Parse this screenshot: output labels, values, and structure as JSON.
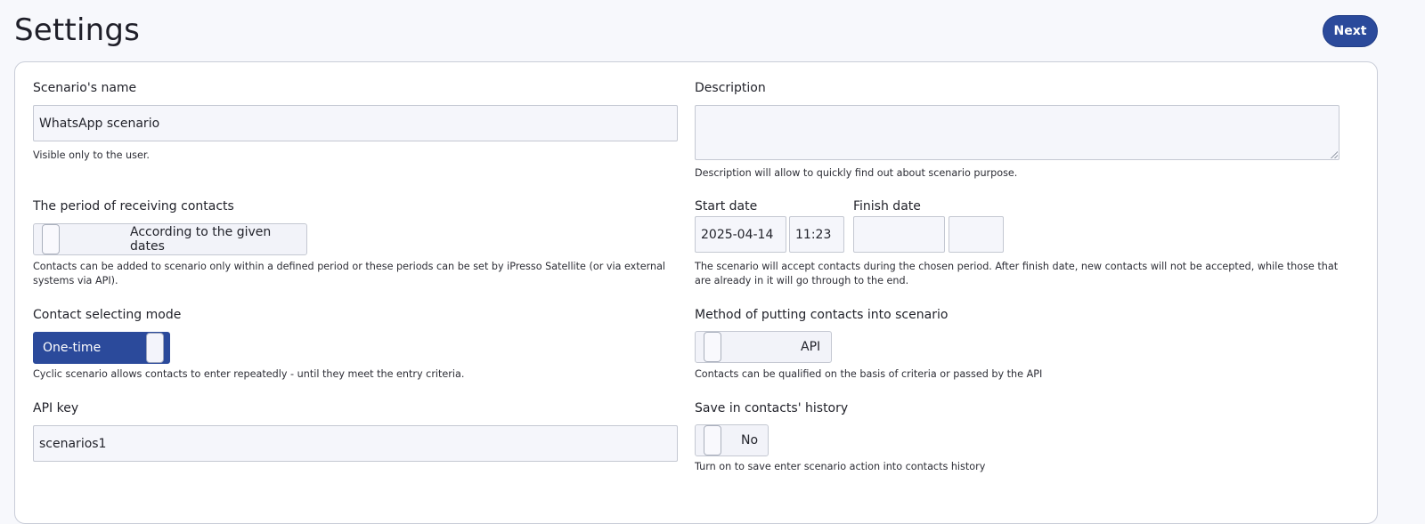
{
  "header": {
    "title": "Settings",
    "next_label": "Next"
  },
  "left": {
    "scenario_name": {
      "label": "Scenario's name",
      "value": "WhatsApp scenario",
      "hint": "Visible only to the user."
    },
    "period": {
      "label": "The period of receiving contacts",
      "toggle_text": "According to the given dates",
      "hint_line1": "Contacts can be added to scenario only within a defined period or these periods can be set by iPresso Satellite (or via external",
      "hint_line2": "systems via API)."
    },
    "selecting_mode": {
      "label": "Contact selecting mode",
      "toggle_text": "One-time",
      "hint": "Cyclic scenario allows contacts to enter repeatedly - until they meet the entry criteria."
    },
    "api_key": {
      "label": "API key",
      "value": "scenarios1"
    }
  },
  "right": {
    "description": {
      "label": "Description",
      "value": "",
      "hint": "Description will allow to quickly find out about scenario purpose."
    },
    "dates": {
      "start_label": "Start date",
      "start_date": "2025-04-14",
      "start_time": "11:23",
      "finish_label": "Finish date",
      "finish_date": "",
      "finish_time": "",
      "hint_line1": "The scenario will accept contacts during the chosen period. After finish date, new contacts will not be accepted, while those that",
      "hint_line2": "are already in it will go through to the end."
    },
    "method": {
      "label": "Method of putting contacts into scenario",
      "toggle_text": "API",
      "hint": "Contacts can be qualified on the basis of criteria or passed by the API"
    },
    "history": {
      "label": "Save in contacts' history",
      "toggle_text": "No",
      "hint": "Turn on to save enter scenario action into contacts history"
    }
  },
  "colors": {
    "accent": "#2b4a9b",
    "field_bg": "#f5f6fb",
    "border": "#c4c8d2"
  }
}
